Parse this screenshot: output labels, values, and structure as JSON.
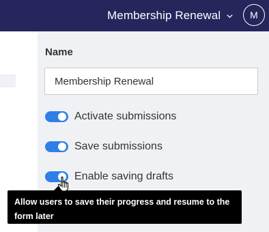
{
  "header": {
    "form_name": "Membership Renewal",
    "avatar_initial": "M"
  },
  "settings": {
    "name_label": "Name",
    "name_value": "Membership Renewal",
    "toggles": [
      {
        "label": "Activate submissions",
        "on": true
      },
      {
        "label": "Save submissions",
        "on": true
      },
      {
        "label": "Enable saving drafts",
        "on": true
      }
    ]
  },
  "tooltip": {
    "text": "Allow users to save their progress and resume to the form later"
  },
  "colors": {
    "topbar": "#26255c",
    "toggle_on": "#2f7fe8",
    "tooltip_bg": "#000000"
  },
  "icons": {
    "form_selector": "chevron-down-icon",
    "cursor": "hand-pointer-icon"
  }
}
